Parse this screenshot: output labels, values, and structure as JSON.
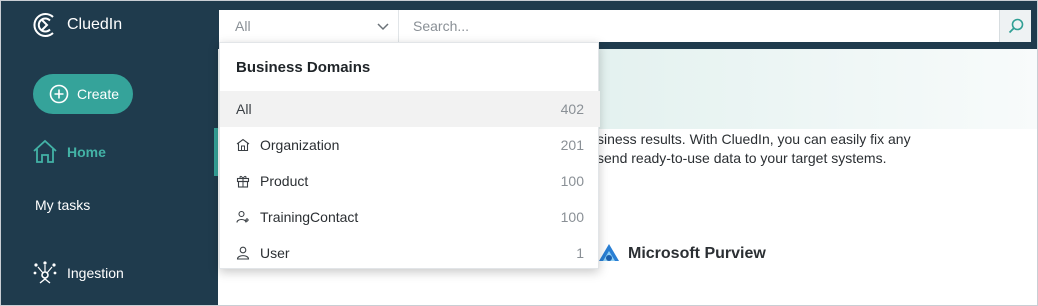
{
  "brand": {
    "name": "CluedIn",
    "logo_icon": "cluedin-logo-icon"
  },
  "search": {
    "scope_value": "All",
    "placeholder": "Search...",
    "chevron_icon": "chevron-down-icon",
    "search_icon": "search-icon"
  },
  "sidebar": {
    "create_label": "Create",
    "items": [
      {
        "label": "Home",
        "icon": "home-icon",
        "active": true
      },
      {
        "label": "My tasks"
      },
      {
        "label": "Ingestion",
        "icon": "ingestion-icon"
      }
    ]
  },
  "main": {
    "hero_line_1": "siness results. With CluedIn, you can easily fix any",
    "hero_line_2": "send ready-to-use data to your target systems.",
    "partner": "Microsoft Purview"
  },
  "dropdown": {
    "title": "Business Domains",
    "items": [
      {
        "label": "All",
        "count": "402",
        "selected": true
      },
      {
        "label": "Organization",
        "count": "201",
        "icon": "building-icon"
      },
      {
        "label": "Product",
        "count": "100",
        "icon": "gift-icon"
      },
      {
        "label": "TrainingContact",
        "count": "100",
        "icon": "user-plus-icon"
      },
      {
        "label": "User",
        "count": "1",
        "icon": "user-icon"
      }
    ]
  },
  "colors": {
    "navy": "#1f3b4d",
    "teal": "#35a39a",
    "teal_text": "#43b3a6"
  }
}
